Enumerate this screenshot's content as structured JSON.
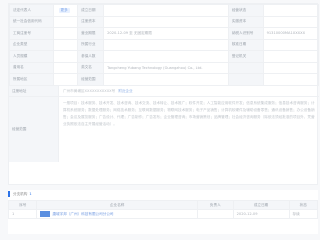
{
  "info": {
    "rows": [
      [
        "法定代表人",
        "",
        "成立日期",
        "",
        "经营状态",
        ""
      ],
      [
        "统一社会信用代码",
        "",
        "注册资本",
        "",
        "实缴资本",
        ""
      ],
      [
        "工商注册号",
        "",
        "营业期限",
        "2020-12-09 至 无固定期限",
        "纳税人识别号",
        "91310000MA1XXXXX"
      ],
      [
        "企业类型",
        "",
        "所属行业",
        "",
        "核准日期",
        ""
      ],
      [
        "人员规模",
        "",
        "参保人数",
        "",
        "登记机关",
        ""
      ],
      [
        "曾用名",
        "",
        "英文名",
        "Tangcheng Yubang Technology (Guangzhou) Co., Ltd.",
        "",
        ""
      ],
      [
        "所属地区",
        "",
        "经营范围",
        "",
        "",
        ""
      ]
    ],
    "tag": "更多"
  },
  "address": {
    "label": "注册地址",
    "value": "广州市黄埔区XXXXXXXXXXX号",
    "link": "附近企业"
  },
  "scope": {
    "label": "经营范围",
    "text": "一般项目：技术服务、技术开发、技术咨询、技术交流、技术转让、技术推广；软件开发；人工智能应用软件开发；信息系统集成服务；信息技术咨询服务；计算机系统服务；数据处理服务；网络技术服务；互联网数据服务；物联网技术服务；电子产品销售；计算机软硬件及辅助设备零售；通讯设备销售；办公设备销售；会议及展览服务；广告设计、代理；广告制作；广告发布；企业管理咨询；市场营销策划；品牌管理；社会经济咨询服务（除依法须经批准的项目外，凭营业执照依法自主开展经营活动）。"
  },
  "subsidiaries": {
    "title": "分支机构",
    "count": "1",
    "headers": [
      "序号",
      "企业名称",
      "负责人",
      "成立日期",
      "状态"
    ],
    "rows": [
      [
        "1",
        "唐城宇邦（广州）科技有限公司分公司",
        "",
        "2020-12-09",
        "存续"
      ]
    ]
  }
}
